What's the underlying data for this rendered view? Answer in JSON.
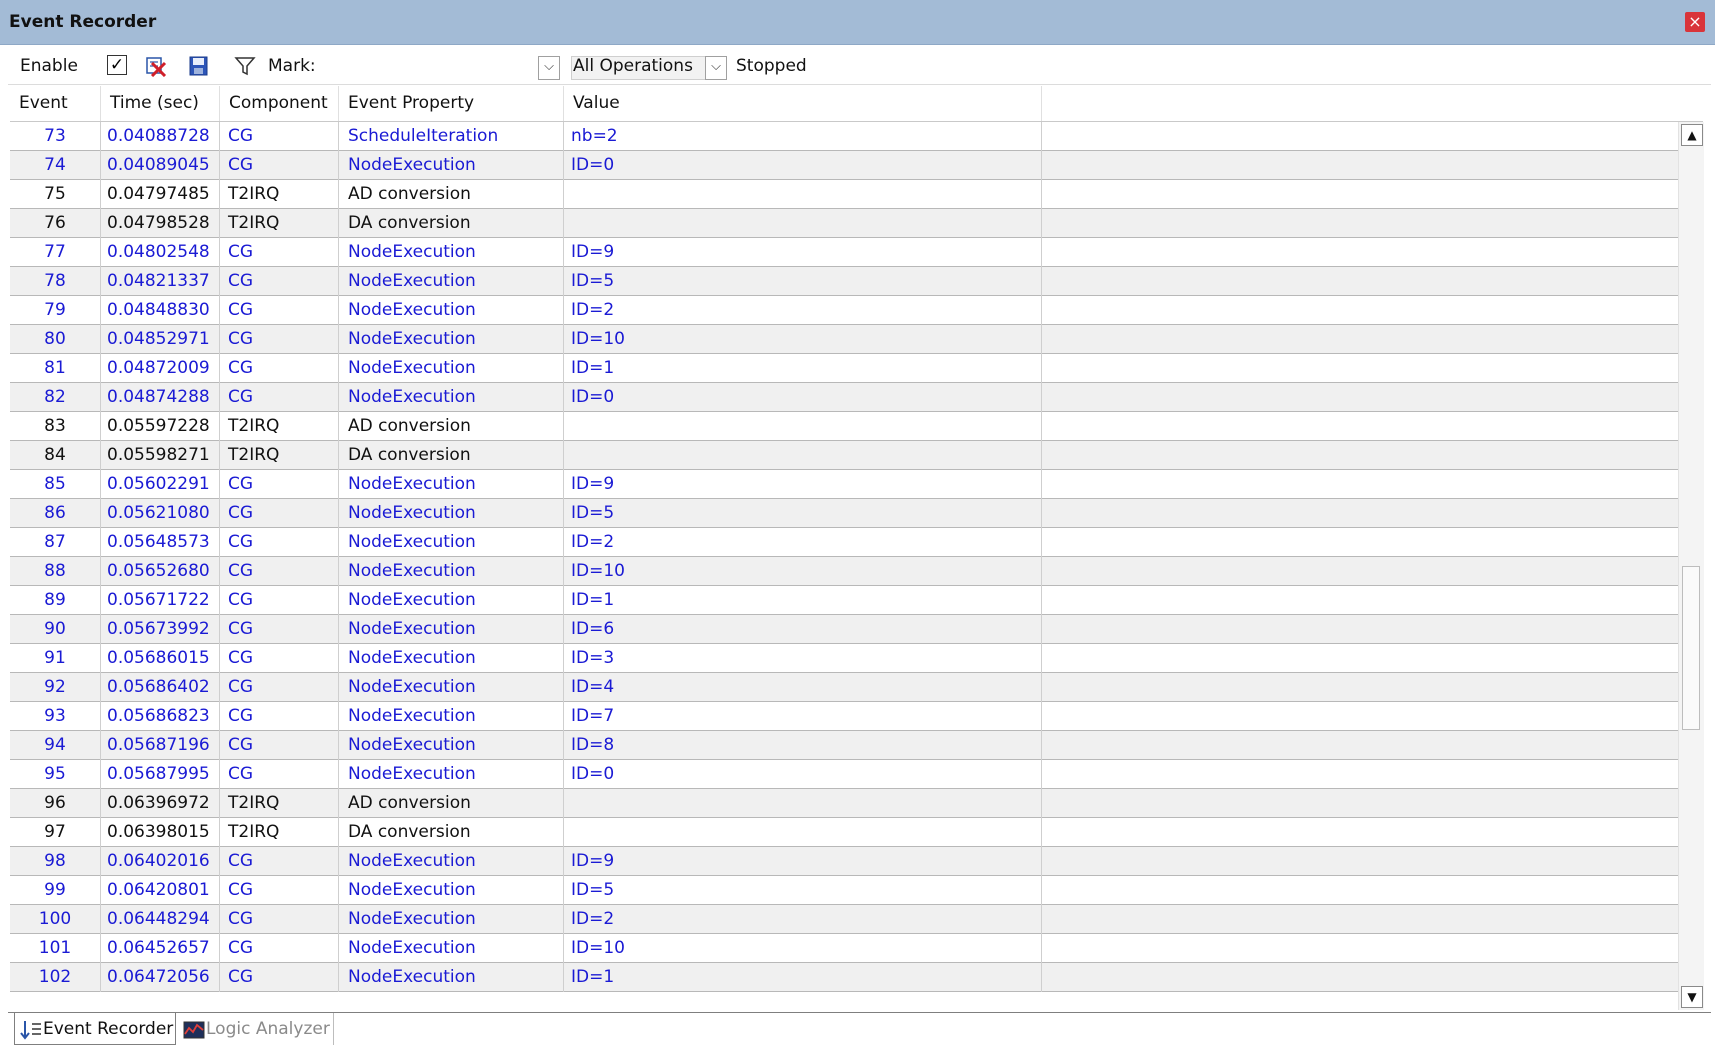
{
  "window": {
    "title": "Event Recorder",
    "close_glyph": "×"
  },
  "toolbar": {
    "enable_label": "Enable",
    "enable_check_glyph": "✓",
    "mark_label": "Mark:",
    "operations_value": "All Operations",
    "status": "Stopped",
    "combo_arrow_glyph": "⌵"
  },
  "columns": [
    "Event",
    "Time (sec)",
    "Component",
    "Event Property",
    "Value"
  ],
  "colors": {
    "cg_text": "#1a1ad4",
    "other_text": "#111111",
    "title_bar": "#a3bbd6",
    "row_alt": "#f0f0f0"
  },
  "rows": [
    {
      "event": "73",
      "time": "0.04088728",
      "component": "CG",
      "property": "ScheduleIteration",
      "value": "nb=2"
    },
    {
      "event": "74",
      "time": "0.04089045",
      "component": "CG",
      "property": "NodeExecution",
      "value": "ID=0"
    },
    {
      "event": "75",
      "time": "0.04797485",
      "component": "T2IRQ",
      "property": "AD conversion",
      "value": ""
    },
    {
      "event": "76",
      "time": "0.04798528",
      "component": "T2IRQ",
      "property": "DA conversion",
      "value": ""
    },
    {
      "event": "77",
      "time": "0.04802548",
      "component": "CG",
      "property": "NodeExecution",
      "value": "ID=9"
    },
    {
      "event": "78",
      "time": "0.04821337",
      "component": "CG",
      "property": "NodeExecution",
      "value": "ID=5"
    },
    {
      "event": "79",
      "time": "0.04848830",
      "component": "CG",
      "property": "NodeExecution",
      "value": "ID=2"
    },
    {
      "event": "80",
      "time": "0.04852971",
      "component": "CG",
      "property": "NodeExecution",
      "value": "ID=10"
    },
    {
      "event": "81",
      "time": "0.04872009",
      "component": "CG",
      "property": "NodeExecution",
      "value": "ID=1"
    },
    {
      "event": "82",
      "time": "0.04874288",
      "component": "CG",
      "property": "NodeExecution",
      "value": "ID=0"
    },
    {
      "event": "83",
      "time": "0.05597228",
      "component": "T2IRQ",
      "property": "AD conversion",
      "value": ""
    },
    {
      "event": "84",
      "time": "0.05598271",
      "component": "T2IRQ",
      "property": "DA conversion",
      "value": ""
    },
    {
      "event": "85",
      "time": "0.05602291",
      "component": "CG",
      "property": "NodeExecution",
      "value": "ID=9"
    },
    {
      "event": "86",
      "time": "0.05621080",
      "component": "CG",
      "property": "NodeExecution",
      "value": "ID=5"
    },
    {
      "event": "87",
      "time": "0.05648573",
      "component": "CG",
      "property": "NodeExecution",
      "value": "ID=2"
    },
    {
      "event": "88",
      "time": "0.05652680",
      "component": "CG",
      "property": "NodeExecution",
      "value": "ID=10"
    },
    {
      "event": "89",
      "time": "0.05671722",
      "component": "CG",
      "property": "NodeExecution",
      "value": "ID=1"
    },
    {
      "event": "90",
      "time": "0.05673992",
      "component": "CG",
      "property": "NodeExecution",
      "value": "ID=6"
    },
    {
      "event": "91",
      "time": "0.05686015",
      "component": "CG",
      "property": "NodeExecution",
      "value": "ID=3"
    },
    {
      "event": "92",
      "time": "0.05686402",
      "component": "CG",
      "property": "NodeExecution",
      "value": "ID=4"
    },
    {
      "event": "93",
      "time": "0.05686823",
      "component": "CG",
      "property": "NodeExecution",
      "value": "ID=7"
    },
    {
      "event": "94",
      "time": "0.05687196",
      "component": "CG",
      "property": "NodeExecution",
      "value": "ID=8"
    },
    {
      "event": "95",
      "time": "0.05687995",
      "component": "CG",
      "property": "NodeExecution",
      "value": "ID=0"
    },
    {
      "event": "96",
      "time": "0.06396972",
      "component": "T2IRQ",
      "property": "AD conversion",
      "value": ""
    },
    {
      "event": "97",
      "time": "0.06398015",
      "component": "T2IRQ",
      "property": "DA conversion",
      "value": ""
    },
    {
      "event": "98",
      "time": "0.06402016",
      "component": "CG",
      "property": "NodeExecution",
      "value": "ID=9"
    },
    {
      "event": "99",
      "time": "0.06420801",
      "component": "CG",
      "property": "NodeExecution",
      "value": "ID=5"
    },
    {
      "event": "100",
      "time": "0.06448294",
      "component": "CG",
      "property": "NodeExecution",
      "value": "ID=2"
    },
    {
      "event": "101",
      "time": "0.06452657",
      "component": "CG",
      "property": "NodeExecution",
      "value": "ID=10"
    },
    {
      "event": "102",
      "time": "0.06472056",
      "component": "CG",
      "property": "NodeExecution",
      "value": "ID=1"
    }
  ],
  "scrollbar": {
    "up_glyph": "▲",
    "down_glyph": "▼"
  },
  "tabs": [
    {
      "label": "Event Recorder",
      "active": true,
      "icon": "event-recorder-icon"
    },
    {
      "label": "Logic Analyzer",
      "active": false,
      "icon": "logic-analyzer-icon"
    }
  ],
  "icons": [
    "checkbox-icon",
    "clear-events-icon",
    "save-icon",
    "filter-icon",
    "dropdown-arrow-icon",
    "close-icon",
    "scroll-up-icon",
    "scroll-down-icon"
  ]
}
